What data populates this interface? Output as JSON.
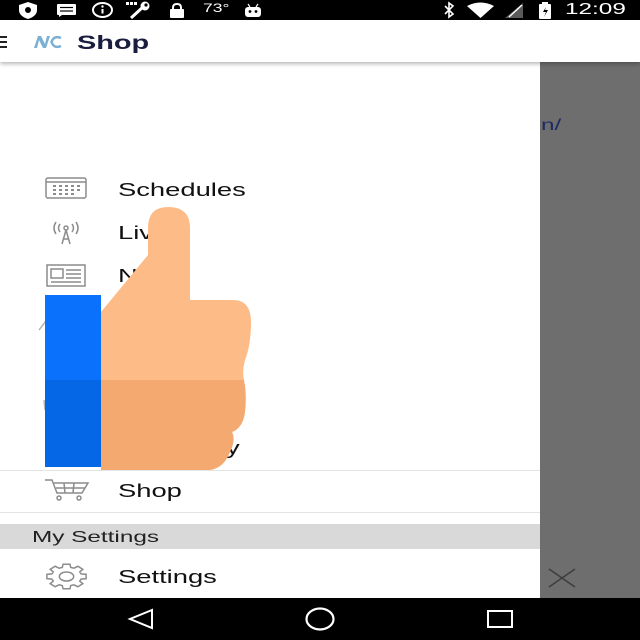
{
  "status_bar": {
    "left_icons": [
      "shield-icon",
      "message-icon",
      "info-icon",
      "tool-icon",
      "lock-icon"
    ],
    "temperature": "73°",
    "extra_icon": "android-icon",
    "right_icons": [
      "bluetooth-icon",
      "wifi-icon",
      "no-signal-icon",
      "battery-icon"
    ],
    "time": "12:09"
  },
  "app_bar": {
    "menu_icon": "menu-icon",
    "logo_icon": "team-logo-icon",
    "title": "Shop"
  },
  "drawer": {
    "items": [
      {
        "label": "Schedules",
        "icon": "calendar-icon"
      },
      {
        "label": "Liv",
        "icon": "antenna-icon"
      },
      {
        "label": "N",
        "icon": "newspaper-icon"
      },
      {
        "label": "y"
      },
      {
        "label": "Shop",
        "icon": "cart-icon"
      }
    ],
    "settings_section": {
      "header": "My Settings",
      "items": [
        {
          "label": "Settings",
          "icon": "gear-icon"
        }
      ]
    }
  },
  "background_content": {
    "link_text": "n/",
    "close_icon": "close-icon"
  },
  "overlay": {
    "icon": "thumbs-up-icon"
  },
  "nav_bar": {
    "icons": [
      "back-icon",
      "home-icon",
      "recents-icon"
    ]
  },
  "colors": {
    "status_bar": "#000000",
    "app_bar": "#ffffff",
    "title": "#1a1d3d",
    "logo": "#7bafd4",
    "drawer_text": "#111111",
    "drawer_icon": "#8c8c8c",
    "section_header_bg": "#d9d9d9",
    "scrim": "#6e6e6e",
    "link": "#1d2a64",
    "overlay_blue": "#0a71fc",
    "overlay_hand": "#fdbb87"
  }
}
